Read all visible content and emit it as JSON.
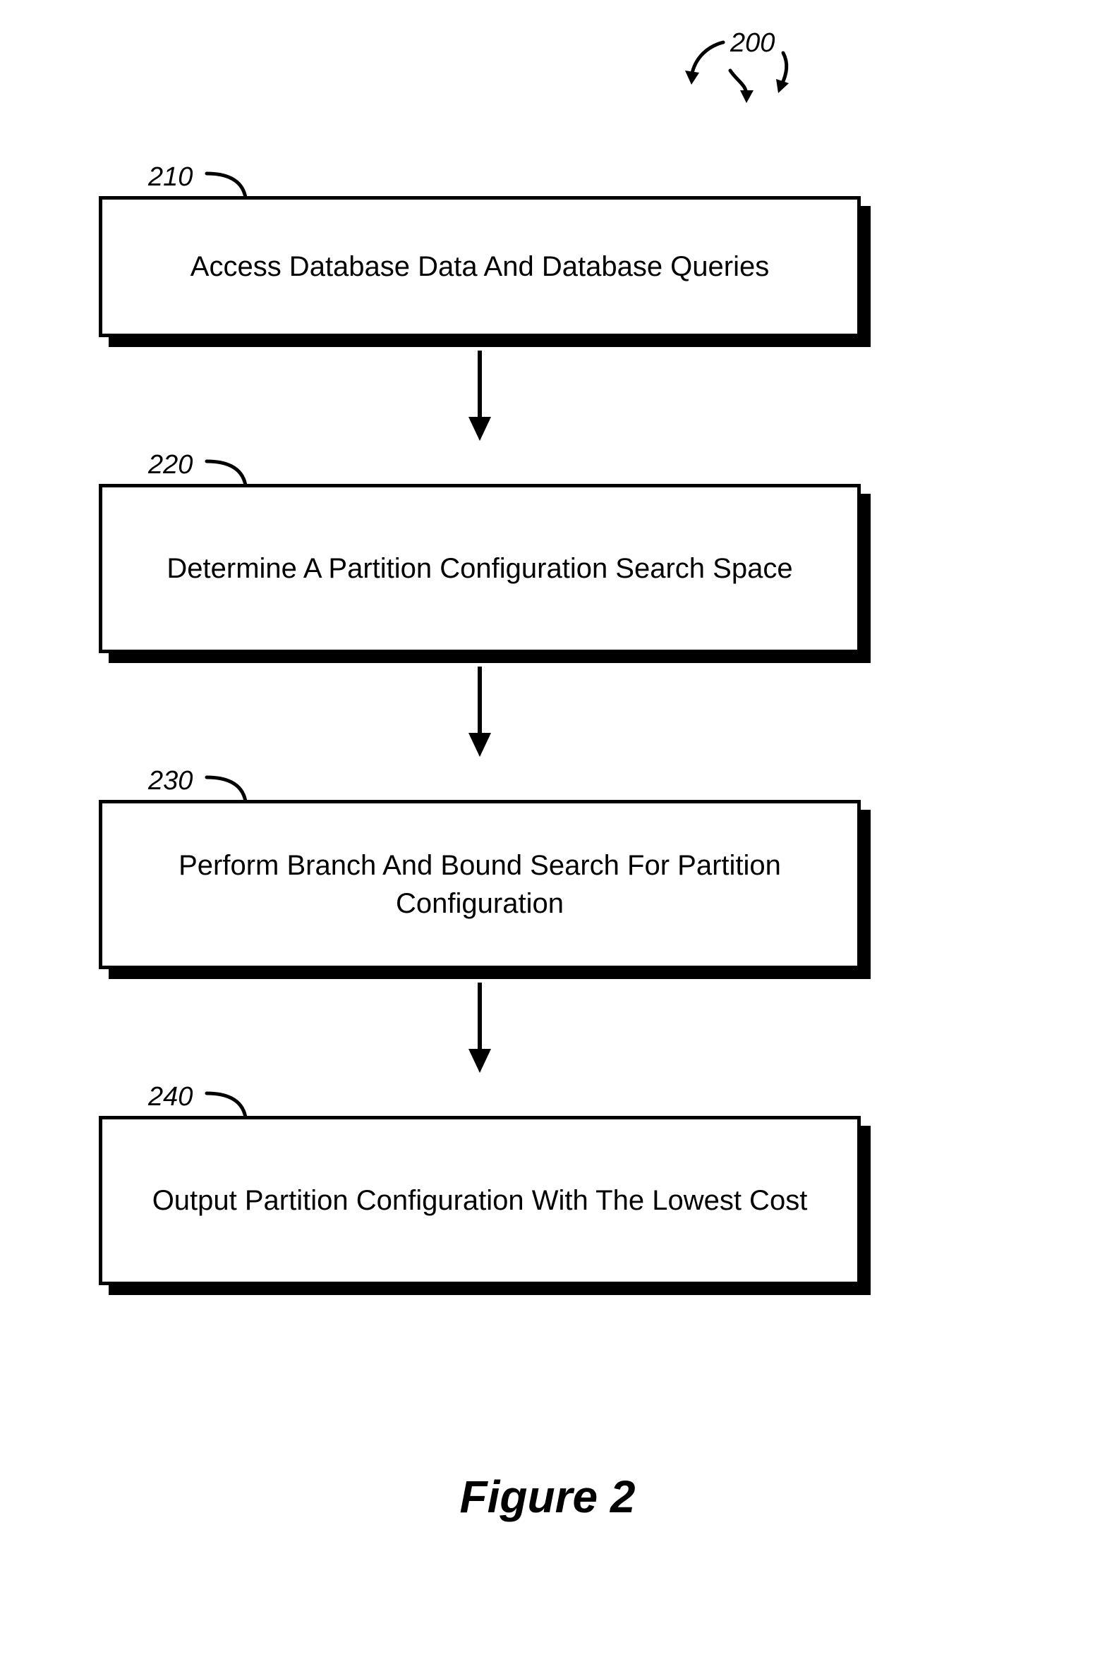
{
  "figure": {
    "ref": "200",
    "caption": "Figure 2"
  },
  "steps": {
    "s210": {
      "ref": "210",
      "text": "Access Database Data And Database Queries"
    },
    "s220": {
      "ref": "220",
      "text": "Determine A Partition Configuration Search Space"
    },
    "s230": {
      "ref": "230",
      "text": "Perform Branch And Bound Search For Partition Configuration"
    },
    "s240": {
      "ref": "240",
      "text": "Output Partition Configuration With The Lowest Cost"
    }
  }
}
